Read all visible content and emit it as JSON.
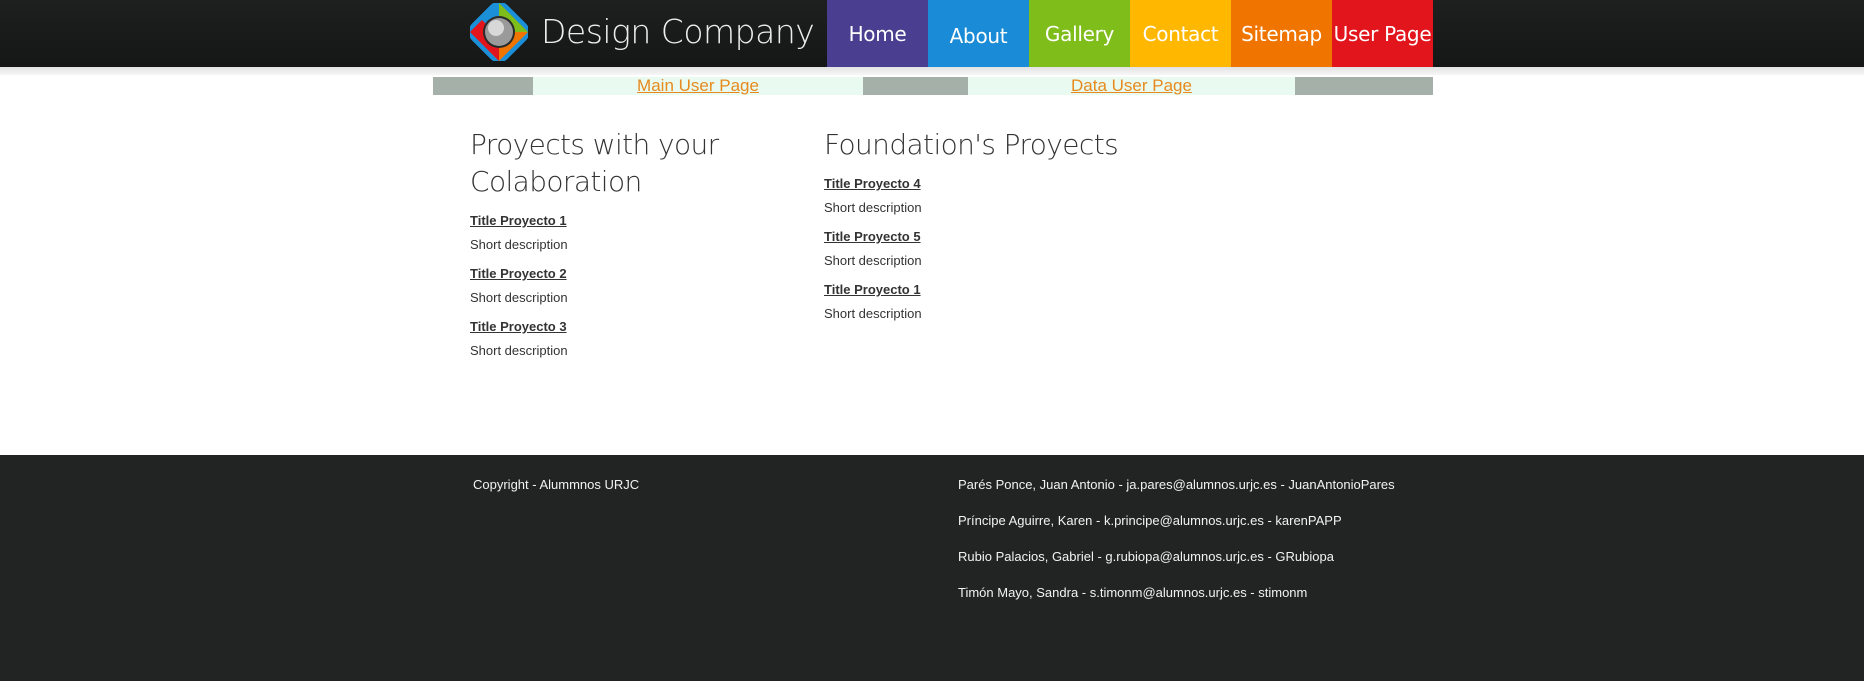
{
  "brand": {
    "name": "Design Company"
  },
  "nav": {
    "items": [
      {
        "label": "Home",
        "color": "#4a3e91"
      },
      {
        "label": "About",
        "color": "#1a8bd6"
      },
      {
        "label": "Gallery",
        "color": "#7fbd1a"
      },
      {
        "label": "Contact",
        "color": "#ffb700"
      },
      {
        "label": "Sitemap",
        "color": "#f07400"
      },
      {
        "label": "User Page",
        "color": "#e2141c"
      }
    ],
    "active": "About"
  },
  "subnav": {
    "main_user_page": "Main User Page",
    "data_user_page": "Data User Page"
  },
  "collab": {
    "heading": "Proyects with your Colaboration",
    "items": [
      {
        "title": "Title Proyecto 1",
        "desc": "Short description"
      },
      {
        "title": "Title Proyecto 2",
        "desc": "Short description"
      },
      {
        "title": "Title Proyecto 3",
        "desc": "Short description"
      }
    ]
  },
  "foundation": {
    "heading": "Foundation's Proyects",
    "items": [
      {
        "title": "Title Proyecto 4",
        "desc": "Short description"
      },
      {
        "title": "Title Proyecto 5",
        "desc": "Short description"
      },
      {
        "title": "Title Proyecto 1",
        "desc": "Short description"
      }
    ]
  },
  "footer": {
    "copyright": "Copyright - Alummnos URJC",
    "authors": [
      "Parés Ponce, Juan Antonio - ja.pares@alumnos.urjc.es - JuanAntonioPares",
      "Príncipe Aguirre, Karen - k.principe@alumnos.urjc.es - karenPAPP",
      "Rubio Palacios, Gabriel - g.rubiopa@alumnos.urjc.es - GRubiopa",
      "Timón Mayo, Sandra - s.timonm@alumnos.urjc.es - stimonm"
    ]
  }
}
